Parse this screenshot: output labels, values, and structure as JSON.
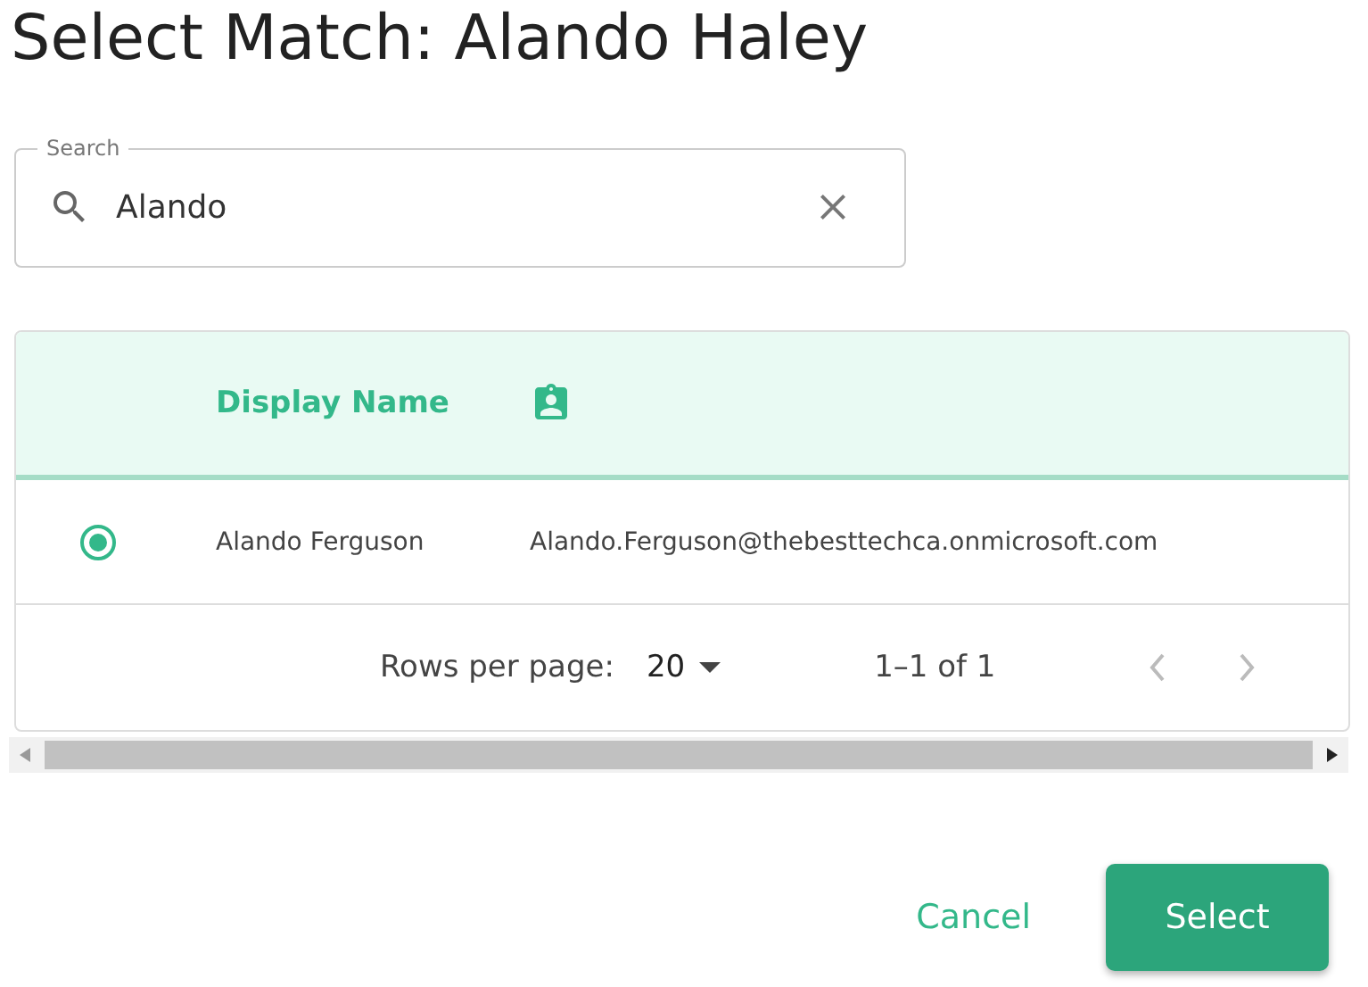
{
  "title": "Select Match: Alando Haley",
  "search": {
    "label": "Search",
    "value": "Alando"
  },
  "table": {
    "columns": [
      "Display Name"
    ],
    "rows": [
      {
        "selected": true,
        "name": "Alando Ferguson",
        "email": "Alando.Ferguson@thebesttechca.onmicrosoft.com"
      }
    ],
    "footer": {
      "rows_per_page_label": "Rows per page:",
      "rows_per_page": "20",
      "range": "1–1 of 1"
    }
  },
  "buttons": [
    {
      "label": "Cancel",
      "kind": "text"
    },
    {
      "label": "Select",
      "kind": "primary"
    }
  ]
}
